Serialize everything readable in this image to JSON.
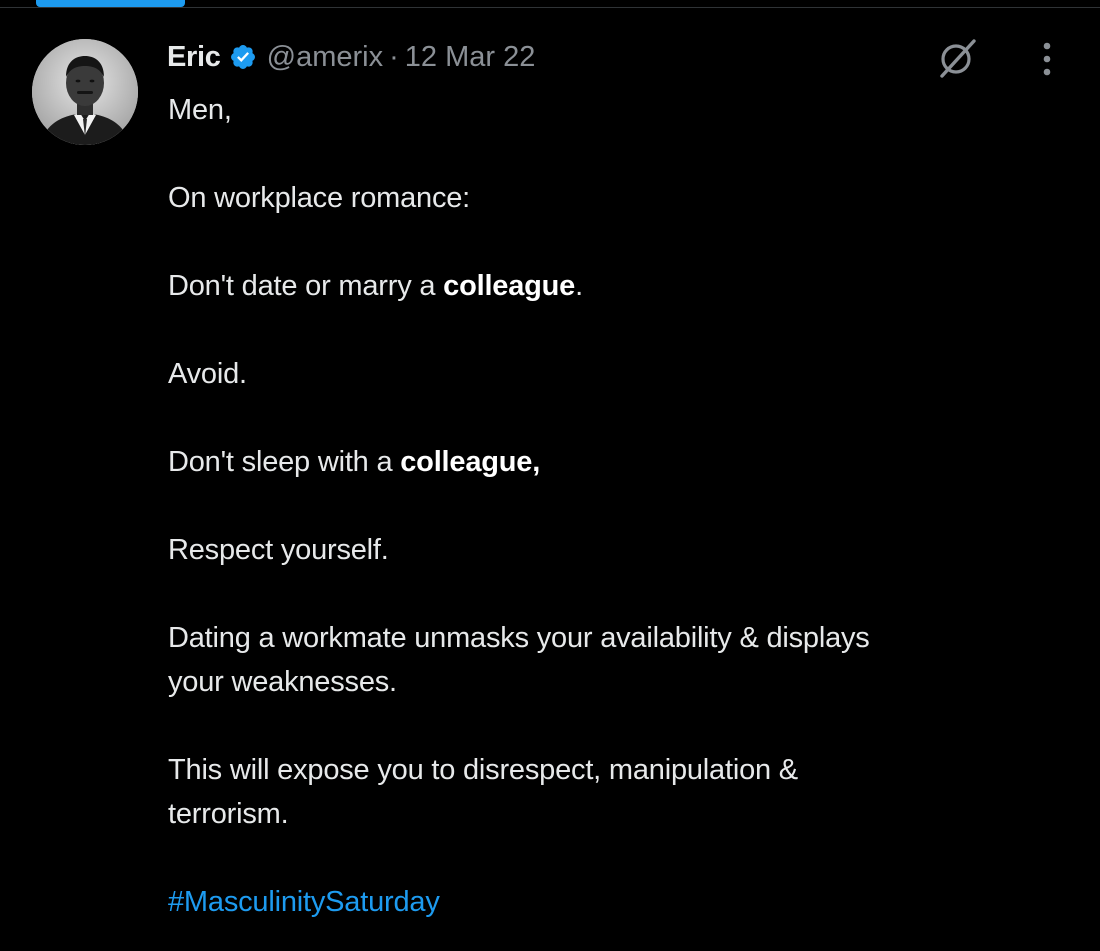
{
  "tweet": {
    "author_name": "Eric",
    "handle": "@amerix",
    "separator": "·",
    "date": "12 Mar 22",
    "paragraphs": {
      "p1": "Men,",
      "p2": "On workplace romance:",
      "p3_pre": "Don't date or marry a ",
      "p3_bold": "colleague",
      "p3_post": ".",
      "p4": "Avoid.",
      "p5_pre": "Don't sleep with a ",
      "p5_bold": "colleague,",
      "p6": "Respect yourself.",
      "p7_line1": "Dating a workmate unmasks your availability & displays",
      "p7_line2": "your weaknesses.",
      "p8_line1": "This will expose you to disrespect, manipulation &",
      "p8_line2": "terrorism."
    },
    "hashtag": "#MasculinitySaturday"
  },
  "icons": {
    "verified": "verified-badge-icon",
    "grok": "grok-icon",
    "more": "more-vertical-icon"
  },
  "colors": {
    "background": "#000000",
    "text": "#e7e9ea",
    "secondary": "#8b9096",
    "accent": "#1d9bf0"
  }
}
